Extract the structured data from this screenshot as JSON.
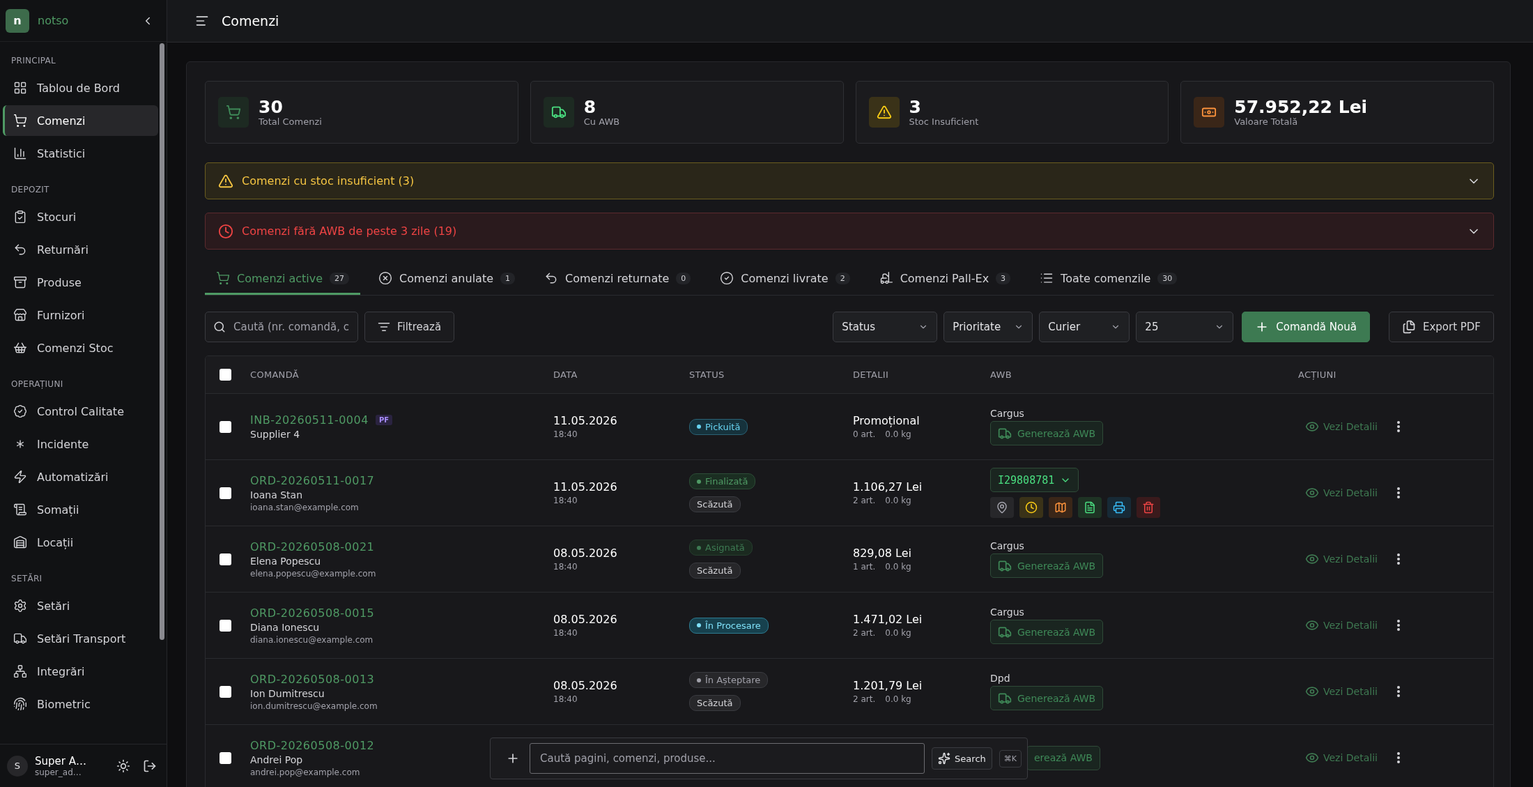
{
  "sidebar": {
    "brand": {
      "initial": "n",
      "name": "notso"
    },
    "sections": [
      {
        "title": "PRINCIPAL",
        "items": [
          {
            "label": "Tablou de Bord",
            "selected": false
          },
          {
            "label": "Comenzi",
            "selected": true
          },
          {
            "label": "Statistici",
            "selected": false
          }
        ]
      },
      {
        "title": "DEPOZIT",
        "items": [
          {
            "label": "Stocuri",
            "selected": false
          },
          {
            "label": "Returnări",
            "selected": false
          },
          {
            "label": "Produse",
            "selected": false
          },
          {
            "label": "Furnizori",
            "selected": false
          },
          {
            "label": "Comenzi Stoc",
            "selected": false
          }
        ]
      },
      {
        "title": "OPERAȚIUNI",
        "items": [
          {
            "label": "Control Calitate",
            "selected": false
          },
          {
            "label": "Incidente",
            "selected": false
          },
          {
            "label": "Automatizări",
            "selected": false
          },
          {
            "label": "Somații",
            "selected": false
          },
          {
            "label": "Locații",
            "selected": false
          }
        ]
      },
      {
        "title": "SETĂRI",
        "items": [
          {
            "label": "Setări",
            "selected": false
          },
          {
            "label": "Setări Transport",
            "selected": false
          },
          {
            "label": "Integrări",
            "selected": false
          },
          {
            "label": "Biometric",
            "selected": false
          }
        ]
      }
    ],
    "user": {
      "initial": "S",
      "name": "Super A…",
      "login": "super_ad…"
    }
  },
  "header": {
    "title": "Comenzi"
  },
  "stats": [
    {
      "kind": "orders",
      "value": "30",
      "label": "Total Comenzi"
    },
    {
      "kind": "awb",
      "value": "8",
      "label": "Cu AWB"
    },
    {
      "kind": "stock",
      "value": "3",
      "label": "Stoc Insuficient"
    },
    {
      "kind": "money",
      "value": "57.952,22 Lei",
      "label": "Valoare Totală"
    }
  ],
  "alerts": [
    {
      "kind": "warning",
      "text": "Comenzi cu stoc insuficient (3)",
      "expanded": false
    },
    {
      "kind": "danger",
      "text": "Comenzi fără AWB de peste 3 zile (19)",
      "expanded": false
    }
  ],
  "tabs": [
    {
      "label": "Comenzi active",
      "count": "27",
      "selected": true
    },
    {
      "label": "Comenzi anulate",
      "count": "1",
      "selected": false
    },
    {
      "label": "Comenzi returnate",
      "count": "0",
      "selected": false
    },
    {
      "label": "Comenzi livrate",
      "count": "2",
      "selected": false
    },
    {
      "label": "Comenzi Pall-Ex",
      "count": "3",
      "selected": false
    },
    {
      "label": "Toate comenzile",
      "count": "30",
      "selected": false
    }
  ],
  "toolbar": {
    "search": {
      "placeholder": "Caută (nr. comandă, c"
    },
    "filter": "Filtrează",
    "selects": [
      "Status",
      "Prioritate",
      "Curier",
      "25"
    ],
    "new_order": "Comandă Nouă",
    "export": "Export PDF"
  },
  "table": {
    "columns": [
      "COMANDĂ",
      "DATA",
      "STATUS",
      "DETALII",
      "AWB",
      "ACȚIUNI"
    ],
    "all_checked": false,
    "rows": [
      {
        "checked": false,
        "number": "INB-20260511-0004",
        "tag": "PF",
        "customer": "Supplier 4",
        "date": "11.05.2026",
        "time": "18:40",
        "status": {
          "label": "Pickuită",
          "kind": "picked"
        },
        "value": "Promoțional",
        "items": "0 art.",
        "weight": "0.0 kg",
        "carrier": "Cargus",
        "awb": {
          "kind": "generate",
          "label": "Generează AWB"
        },
        "action": "Vezi Detalii"
      },
      {
        "checked": false,
        "number": "ORD-20260511-0017",
        "customer": "Ioana Stan",
        "email": "ioana.stan@example.com",
        "date": "11.05.2026",
        "time": "18:40",
        "status": {
          "label": "Finalizată",
          "kind": "done"
        },
        "priority": "Scăzută",
        "value": "1.106,27 Lei",
        "items": "2 art.",
        "weight": "0.0 kg",
        "awb": {
          "kind": "issued",
          "number": "I29808781"
        },
        "action": "Vezi Detalii"
      },
      {
        "checked": false,
        "number": "ORD-20260508-0021",
        "customer": "Elena Popescu",
        "email": "elena.popescu@example.com",
        "date": "08.05.2026",
        "time": "18:40",
        "status": {
          "label": "Asignată",
          "kind": "assigned"
        },
        "priority": "Scăzută",
        "value": "829,08 Lei",
        "items": "1 art.",
        "weight": "0.0 kg",
        "carrier": "Cargus",
        "awb": {
          "kind": "generate",
          "label": "Generează AWB"
        },
        "action": "Vezi Detalii"
      },
      {
        "checked": false,
        "number": "ORD-20260508-0015",
        "customer": "Diana Ionescu",
        "email": "diana.ionescu@example.com",
        "date": "08.05.2026",
        "time": "18:40",
        "status": {
          "label": "În Procesare",
          "kind": "processing"
        },
        "value": "1.471,02 Lei",
        "items": "2 art.",
        "weight": "0.0 kg",
        "carrier": "Cargus",
        "awb": {
          "kind": "generate",
          "label": "Generează AWB"
        },
        "action": "Vezi Detalii"
      },
      {
        "checked": false,
        "number": "ORD-20260508-0013",
        "customer": "Ion Dumitrescu",
        "email": "ion.dumitrescu@example.com",
        "date": "08.05.2026",
        "time": "18:40",
        "status": {
          "label": "În Așteptare",
          "kind": "waiting"
        },
        "priority": "Scăzută",
        "value": "1.201,79 Lei",
        "items": "2 art.",
        "weight": "0.0 kg",
        "carrier": "Dpd",
        "awb": {
          "kind": "generate",
          "label": "Generează AWB"
        },
        "action": "Vezi Detalii"
      },
      {
        "checked": false,
        "number": "ORD-20260508-0012",
        "customer": "Andrei Pop",
        "email": "andrei.pop@example.com",
        "awb": {
          "kind": "partial",
          "label": "erează AWB"
        },
        "action": "Vezi Detalii"
      }
    ]
  },
  "command_bar": {
    "placeholder": "Caută pagini, comenzi, produse...",
    "search": "Search",
    "shortcut": "⌘K"
  }
}
